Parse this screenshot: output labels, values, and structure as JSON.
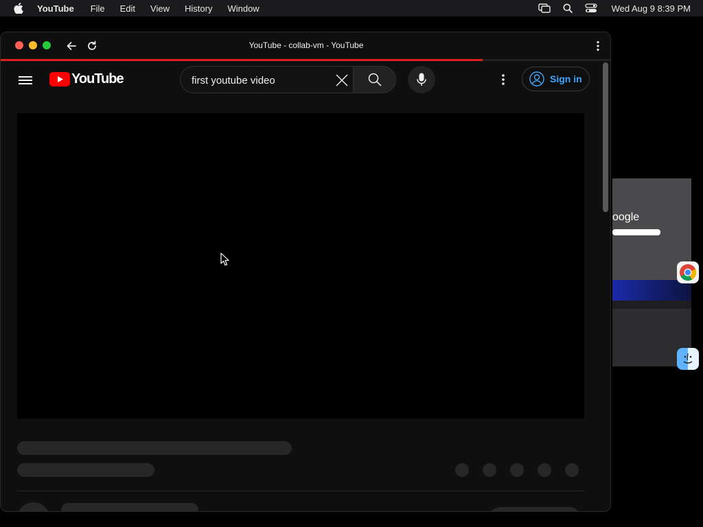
{
  "menubar": {
    "app_name": "YouTube",
    "items": [
      "File",
      "Edit",
      "View",
      "History",
      "Window"
    ],
    "clock": "Wed Aug 9  8:39 PM"
  },
  "window": {
    "title": "YouTube - collab-vm - YouTube",
    "load_progress_percent": 79
  },
  "youtube": {
    "logo_text": "YouTube",
    "search": {
      "value": "first youtube video"
    },
    "sign_in_label": "Sign in"
  },
  "icons": {
    "apple": "apple-icon",
    "screen_mirror": "screen-mirroring-icon",
    "spotlight": "search-icon",
    "control_center": "control-center-icon",
    "back": "arrow-left-icon",
    "reload": "reload-icon",
    "menu_dots": "more-vertical-icon",
    "hamburger": "hamburger-menu-icon",
    "clear": "close-icon",
    "search": "search-icon",
    "mic": "microphone-icon",
    "account": "account-circle-icon"
  },
  "colors": {
    "youtube_red": "#ff0000",
    "sign_in_blue": "#3ea6ff",
    "page_bg": "#0f0f0f",
    "skeleton": "#272727"
  },
  "background_window": {
    "logo_fragment": "oogle"
  }
}
